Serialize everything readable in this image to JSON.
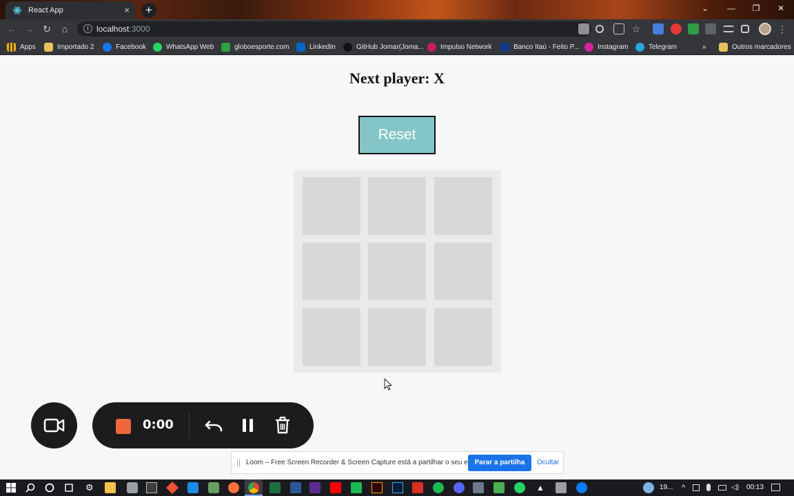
{
  "browser": {
    "tab_title": "React App",
    "tab_close": "×",
    "new_tab": "+",
    "url_host": "localhost",
    "url_port": ":3000"
  },
  "bookmarks": [
    {
      "label": "Apps",
      "color": "#f4b400"
    },
    {
      "label": "Importado 2",
      "color": "#e8c25b"
    },
    {
      "label": "Facebook",
      "color": "#1877f2"
    },
    {
      "label": "WhatsApp Web",
      "color": "#25d366"
    },
    {
      "label": "globoesporte.com",
      "color": "#2ea043"
    },
    {
      "label": "LinkedIn",
      "color": "#0a66c2"
    },
    {
      "label": "GitHub Jomar(Joma...",
      "color": "#111111"
    },
    {
      "label": "Impulso Network",
      "color": "#c81e5a"
    },
    {
      "label": "Banco Itaú - Feito P...",
      "color": "#123c8c"
    },
    {
      "label": "Instagram",
      "color": "#d6249f"
    },
    {
      "label": "Telegram",
      "color": "#2aa3df"
    }
  ],
  "bookmarks_more": "»",
  "bookmarks_other": "Outros marcadores",
  "game": {
    "status": "Next player: X",
    "reset_label": "Reset",
    "cells": [
      "",
      "",
      "",
      "",
      "",
      "",
      "",
      "",
      ""
    ]
  },
  "recorder": {
    "time": "0:00",
    "stop_color": "#f0653b"
  },
  "share_bar": {
    "message": "Loom – Free Screen Recorder & Screen Capture está a partilhar o seu ecrã.",
    "stop_label": "Parar a partilha",
    "hide_label": "Ocultar"
  },
  "taskbar": {
    "weather_temp": "19...",
    "clock": "00:13"
  }
}
